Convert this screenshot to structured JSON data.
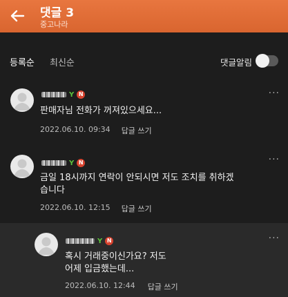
{
  "header": {
    "title": "댓글 3",
    "subtitle": "중고나라"
  },
  "sort": {
    "registered": "등록순",
    "newest": "최신순",
    "notify_label": "댓글알림",
    "notify_on": false
  },
  "comments": [
    {
      "grade": "Y",
      "badge": "N",
      "more": "···",
      "text": "판매자님 전화가 꺼져있으세요...",
      "date": "2022.06.10. 09:34",
      "reply": "답글 쓰기"
    },
    {
      "grade": "Y",
      "badge": "N",
      "more": "···",
      "text": "금일 18시까지 연락이 안되시면 저도 조치를 취하겠습니다",
      "date": "2022.06.10. 12:15",
      "reply": "답글 쓰기"
    },
    {
      "grade": "Y",
      "badge": "N",
      "more": "···",
      "text": "혹시 거래중이신가요? 저도 어제 입금했는데...",
      "date": "2022.06.10. 12:44",
      "reply": "답글 쓰기"
    }
  ]
}
